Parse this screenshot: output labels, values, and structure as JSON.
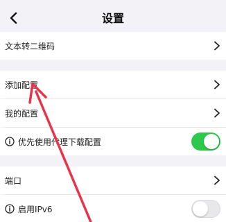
{
  "header": {
    "title": "设置"
  },
  "rows": {
    "text_to_qr": "文本转二维码",
    "add_config": "添加配置",
    "my_config": "我的配置",
    "proxy_download": "优先使用代理下载配置",
    "port": "端口",
    "ipv6": "启用IPv6"
  },
  "toggles": {
    "proxy_download": true,
    "ipv6": false
  },
  "colors": {
    "toggle_on": "#2ec84d",
    "annotation_arrow": "#e8344a"
  },
  "icons": {
    "back": "chevron-left-icon",
    "chevron": "chevron-right-icon",
    "info": "info-icon"
  }
}
